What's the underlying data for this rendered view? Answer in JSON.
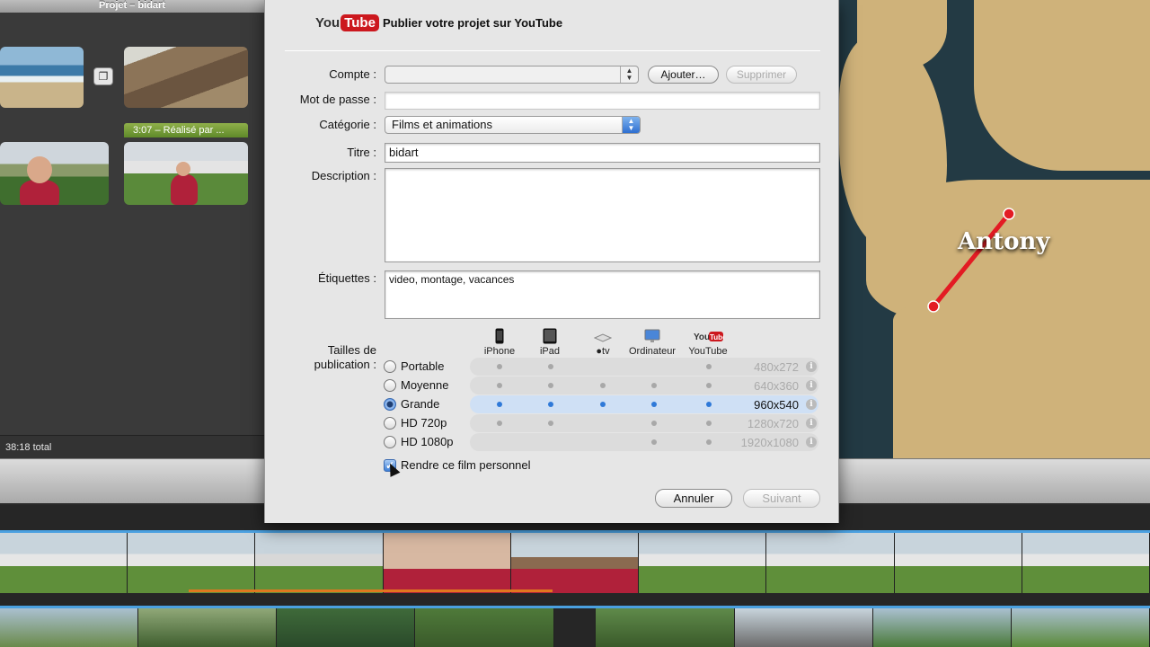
{
  "project": {
    "title": "Projet – bidart",
    "clip_tag": "3:07 – Réalisé par ...",
    "total": "38:18 total"
  },
  "preview": {
    "map_label": "Antony"
  },
  "dialog": {
    "brand_you": "You",
    "brand_tube": "Tube",
    "title": "Publier votre projet sur YouTube",
    "account_label": "Compte :",
    "account_value": "",
    "add_button": "Ajouter…",
    "remove_button": "Supprimer",
    "password_label": "Mot de passe :",
    "password_value": "",
    "category_label": "Catégorie :",
    "category_value": "Films et animations",
    "title_label": "Titre :",
    "title_value": "bidart",
    "description_label": "Description :",
    "description_value": "",
    "tags_label": "Étiquettes :",
    "tags_value": "video, montage, vacances",
    "sizes_label_line1": "Tailles de",
    "sizes_label_line2": "publication :",
    "devices": [
      {
        "name": "iPhone",
        "icon": "iphone-icon"
      },
      {
        "name": "iPad",
        "icon": "ipad-icon"
      },
      {
        "name": "tv",
        "icon": "apple-tv-icon"
      },
      {
        "name": "Ordinateur",
        "icon": "computer-icon"
      },
      {
        "name": "YouTube",
        "icon": "youtube-icon"
      }
    ],
    "sizes": [
      {
        "name": "Portable",
        "resolution": "480x272",
        "selected": false,
        "devices": [
          true,
          true,
          false,
          false,
          true
        ]
      },
      {
        "name": "Moyenne",
        "resolution": "640x360",
        "selected": false,
        "devices": [
          true,
          true,
          true,
          true,
          true
        ]
      },
      {
        "name": "Grande",
        "resolution": "960x540",
        "selected": true,
        "devices": [
          true,
          true,
          true,
          true,
          true
        ]
      },
      {
        "name": "HD 720p",
        "resolution": "1280x720",
        "selected": false,
        "devices": [
          true,
          true,
          false,
          true,
          true
        ]
      },
      {
        "name": "HD 1080p",
        "resolution": "1920x1080",
        "selected": false,
        "devices": [
          false,
          false,
          false,
          true,
          true
        ]
      }
    ],
    "personal_checkbox_label": "Rendre ce film personnel",
    "personal_checked": true,
    "cancel_button": "Annuler",
    "next_button": "Suivant"
  }
}
